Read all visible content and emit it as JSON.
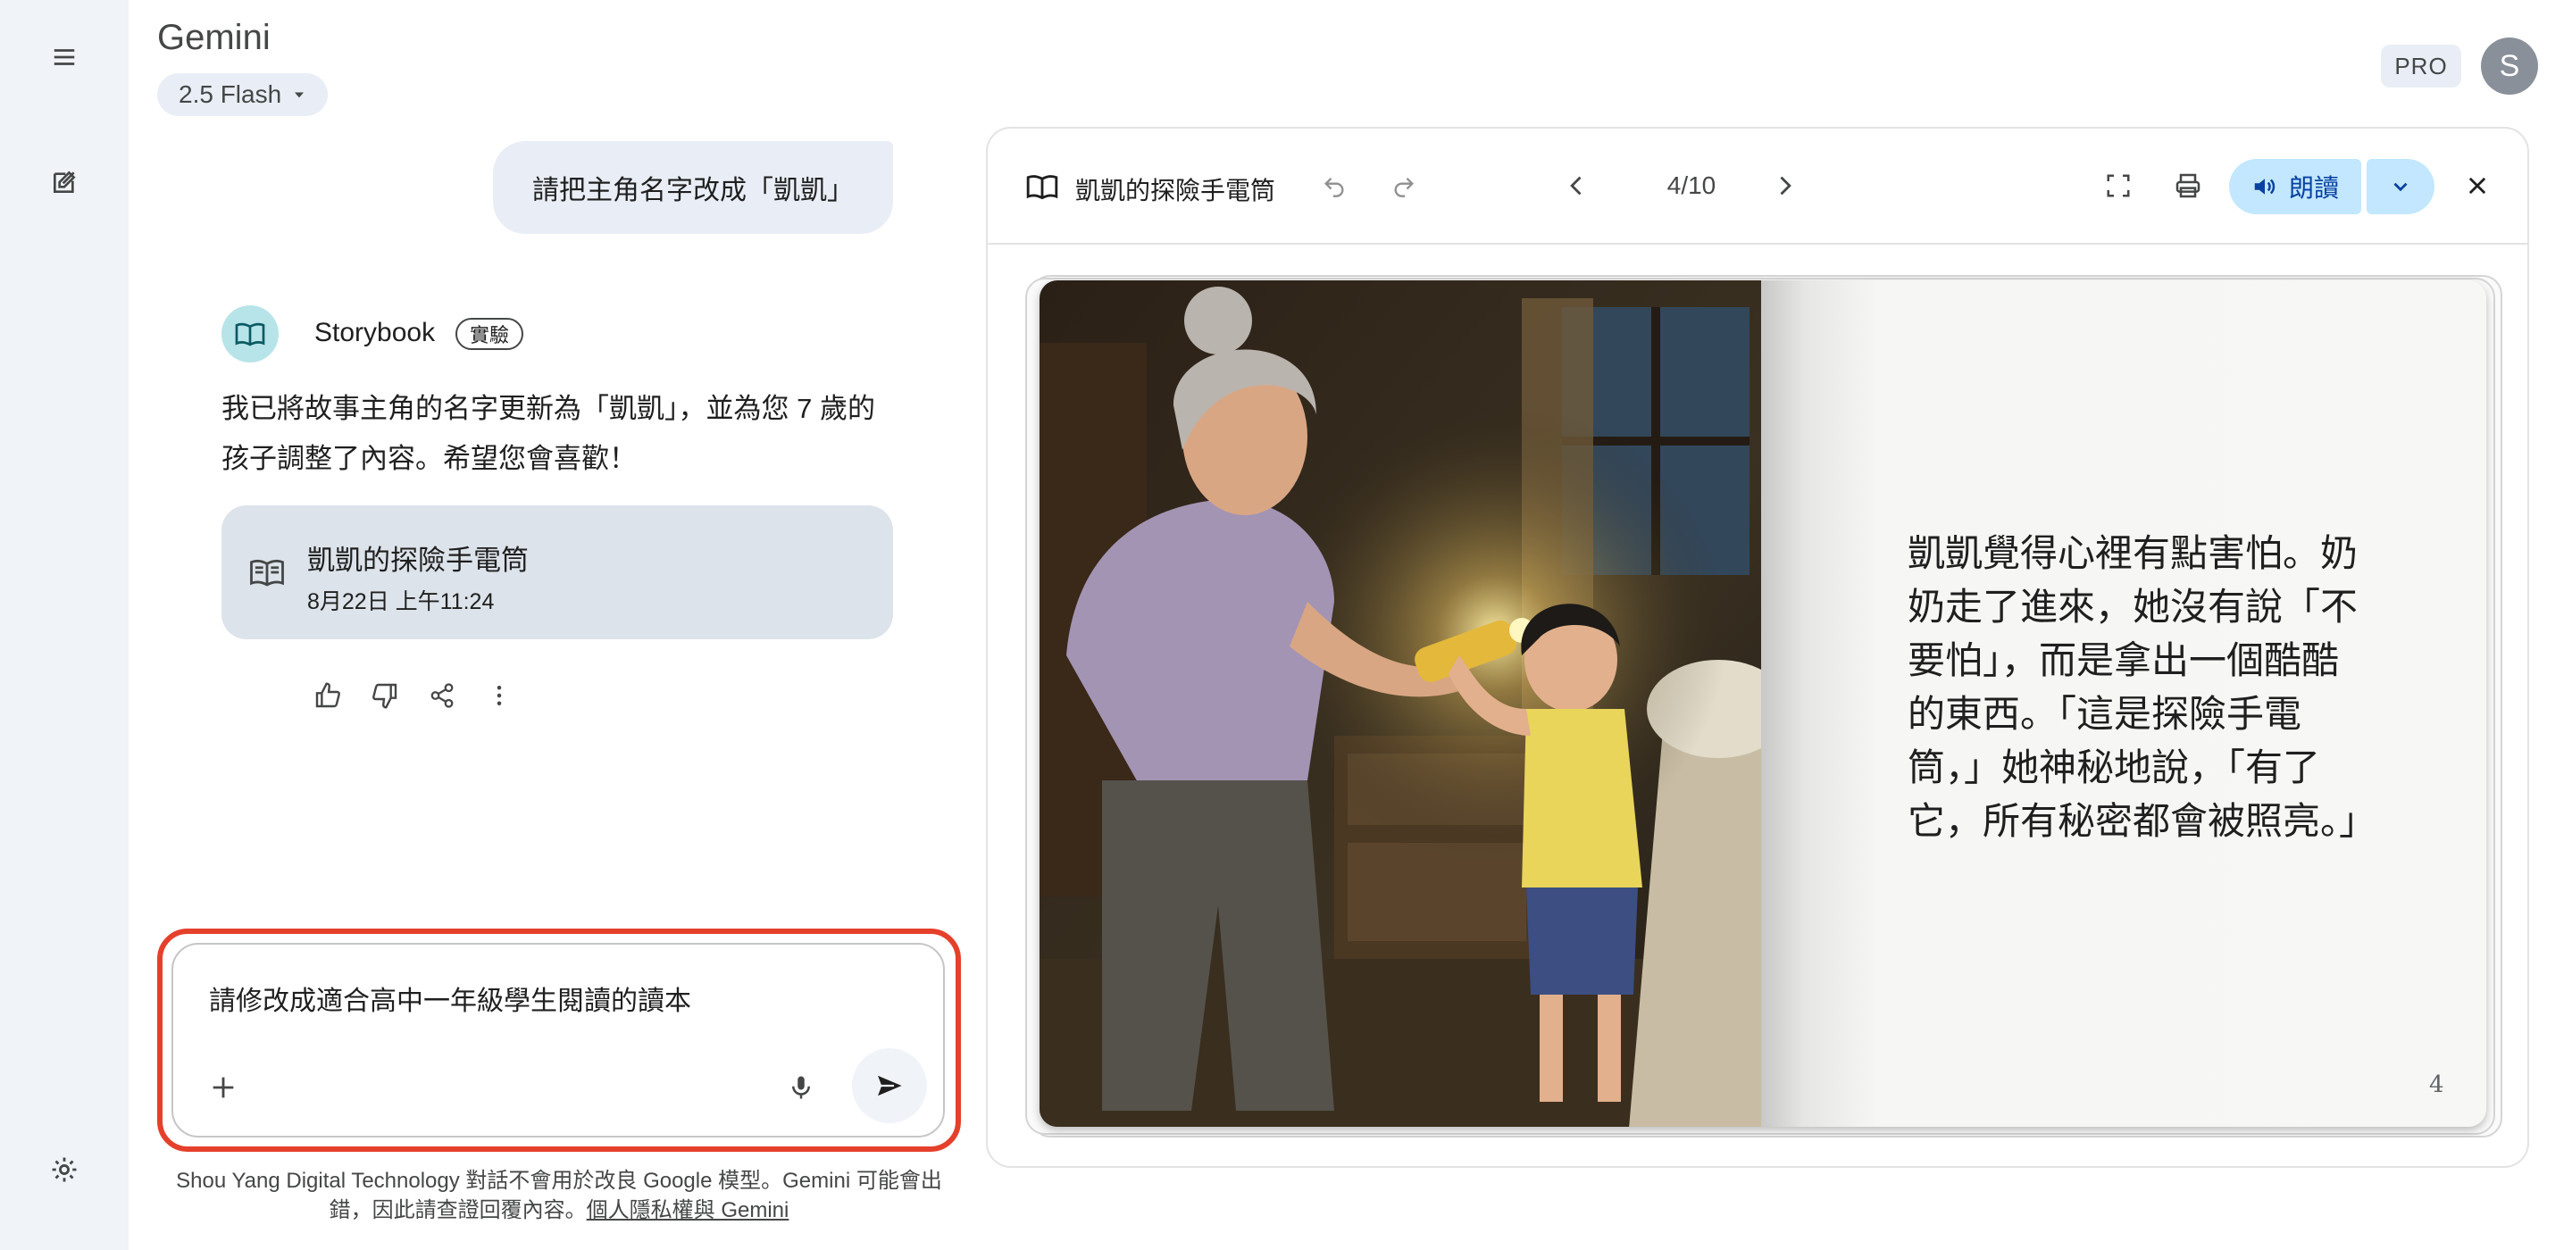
{
  "app": {
    "title": "Gemini",
    "model": "2.5 Flash",
    "plan_badge": "PRO",
    "avatar_initial": "S"
  },
  "rail": {
    "icons": [
      "menu-icon",
      "new-chat-icon",
      "settings-icon"
    ]
  },
  "chat": {
    "user_message": "請把主角名字改成「凱凱」",
    "bot": {
      "name": "Storybook",
      "badge": "實驗",
      "text": "我已將故事主角的名字更新為「凱凱」，並為您 7 歲的孩子調整了內容。希望您會喜歡！",
      "doc_card": {
        "title": "凱凱的探險手電筒",
        "date": "8月22日 上午11:24"
      }
    },
    "feedback_icons": [
      "thumbs-up-icon",
      "thumbs-down-icon",
      "share-icon",
      "more-icon"
    ]
  },
  "input": {
    "text": "請修改成適合高中一年級學生閱讀的讀本",
    "disclaimer": "Shou Yang Digital Technology 對話不會用於改良 Google 模型。Gemini 可能會出錯，因此請查證回覆內容。",
    "privacy_link": "個人隱私權與 Gemini"
  },
  "storybook": {
    "title": "凱凱的探險手電筒",
    "page_indicator": "4/10",
    "read_label": "朗讀",
    "page_text": "凱凱覺得心裡有點害怕。奶奶走了進來，她沒有說「不要怕」，而是拿出一個酷酷的東西。「這是探險手電筒，」她神秘地說，「有了它，所有秘密都會被照亮。」",
    "page_number": "4"
  },
  "colors": {
    "accent": "#c2e7ff",
    "highlight_frame": "#e5402b",
    "rail_bg": "#f0f4f9"
  }
}
